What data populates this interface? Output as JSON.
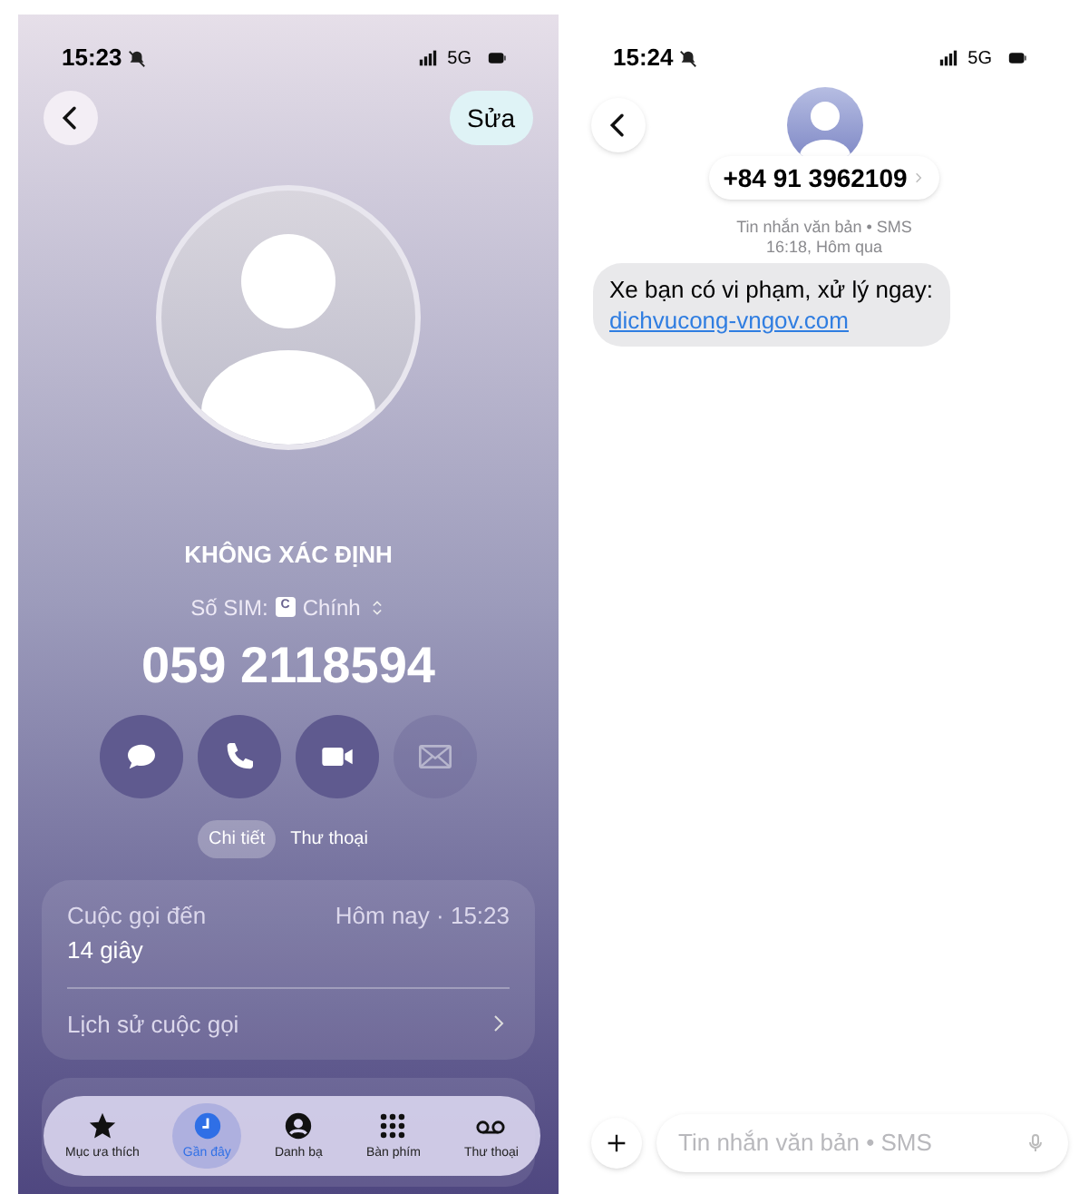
{
  "call_screen": {
    "status_bar": {
      "time": "15:23",
      "network": "5G"
    },
    "edit_button": "Sửa",
    "contact_name": "KHÔNG XÁC ĐỊNH",
    "sim": {
      "label": "Số SIM:",
      "badge": "C",
      "value": "Chính"
    },
    "phone_number": "059 2118594",
    "actions": [
      {
        "kind": "message",
        "disabled": false
      },
      {
        "kind": "call",
        "disabled": false
      },
      {
        "kind": "video",
        "disabled": false
      },
      {
        "kind": "mail",
        "disabled": true
      }
    ],
    "segments": [
      {
        "label": "Chi tiết",
        "selected": true
      },
      {
        "label": "Thư thoại",
        "selected": false
      }
    ],
    "call_card": {
      "type": "Cuộc gọi đến",
      "time": "Hôm nay · 15:23",
      "duration": "14 giây",
      "history": "Lịch sử cuộc gọi"
    },
    "tab_bar": [
      {
        "kind": "favorites",
        "label": "Mục ưa thích",
        "selected": false
      },
      {
        "kind": "recents",
        "label": "Gần đây",
        "selected": true
      },
      {
        "kind": "contacts",
        "label": "Danh bạ",
        "selected": false
      },
      {
        "kind": "keypad",
        "label": "Bàn phím",
        "selected": false
      },
      {
        "kind": "voicemail",
        "label": "Thư thoại",
        "selected": false
      }
    ]
  },
  "sms_screen": {
    "status_bar": {
      "time": "15:24",
      "network": "5G"
    },
    "sender": "+84 91 3962109",
    "meta": "Tin nhắn văn bản • SMS",
    "timestamp": "16:18, Hôm qua",
    "messages": [
      {
        "text": "Xe bạn có vi phạm, xử lý ngay:",
        "link": "dichvucong-vngov.com"
      }
    ],
    "input": {
      "placeholder": "Tin nhắn văn bản • SMS"
    }
  }
}
